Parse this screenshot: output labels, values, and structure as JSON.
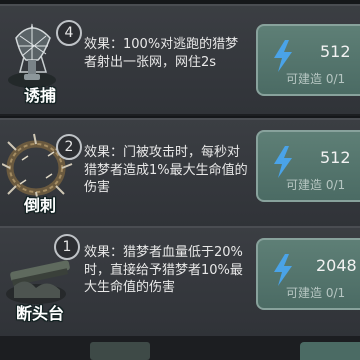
{
  "talents": [
    {
      "name": "诱捕",
      "level": "4",
      "effect_label": "效果：",
      "effect_text": "100%对逃跑的猎梦者射出一张网，网住2s",
      "cost": "512",
      "status": "可建造 0/1",
      "icon": "net-icon"
    },
    {
      "name": "倒刺",
      "level": "2",
      "effect_label": "效果：",
      "effect_text": "门被攻击时，每秒对猎梦者造成1%最大生命值的伤害",
      "cost": "512",
      "status": "可建造 0/1",
      "icon": "thorn-wreath-icon"
    },
    {
      "name": "断头台",
      "level": "1",
      "effect_label": "效果：",
      "effect_text": "猎梦者血量低于20%时，直接给予猎梦者10%最大生命值的伤害",
      "cost": "2048",
      "status": "可建造 0/1",
      "icon": "guillotine-icon"
    }
  ],
  "colors": {
    "button_bg": "#587a71",
    "panel_bg": "#35383d",
    "bolt": "#4aa3e8"
  }
}
